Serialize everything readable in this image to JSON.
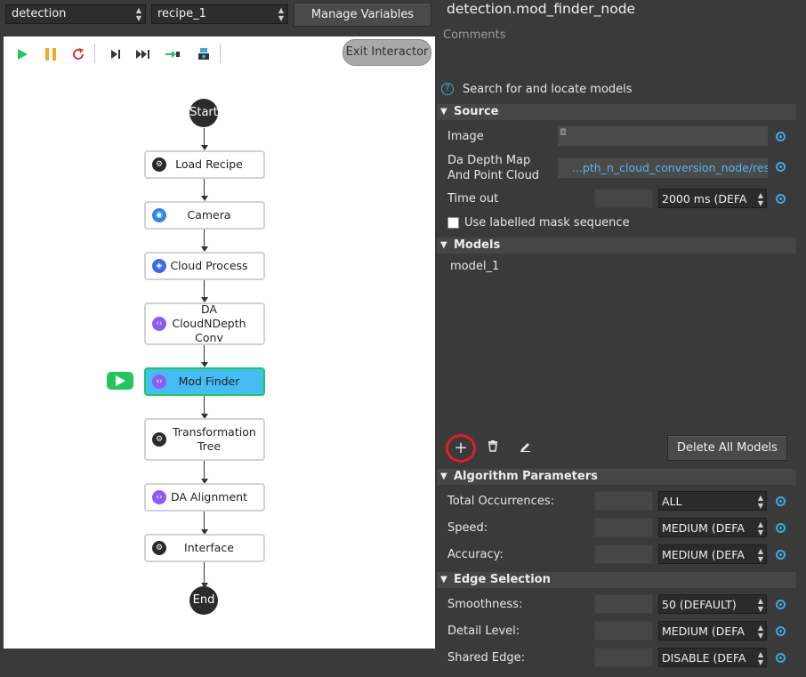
{
  "toolbar": {
    "project_select": "detection",
    "recipe_select": "recipe_1",
    "manage_variables": "Manage Variables"
  },
  "canvas": {
    "exit_interactor": "Exit Interactor",
    "start": "Start",
    "end": "End",
    "nodes": [
      {
        "label": "Load Recipe",
        "icon": "gear-icon"
      },
      {
        "label": "Camera",
        "icon": "camera-icon"
      },
      {
        "label": "Cloud Process",
        "icon": "cube-icon"
      },
      {
        "label": "DA CloudNDepth Conv",
        "icon": "code-icon"
      },
      {
        "label": "Mod Finder",
        "icon": "code-icon",
        "active": true
      },
      {
        "label": "Transformation Tree",
        "icon": "gear-icon"
      },
      {
        "label": "DA Alignment",
        "icon": "code-icon"
      },
      {
        "label": "Interface",
        "icon": "gear-icon"
      }
    ]
  },
  "panel": {
    "title": "detection.mod_finder_node",
    "comments": "Comments",
    "help_text": "Search for and locate models",
    "source": {
      "header": "Source",
      "image_label": "Image",
      "depth_label": "Da Depth Map And Point Cloud",
      "depth_value": "...pth_n_cloud_conversion_node/result",
      "timeout_label": "Time out",
      "timeout_value": "2000 ms (DEFA",
      "mask_seq_label": "Use labelled mask sequence"
    },
    "models": {
      "header": "Models",
      "items": [
        "model_1"
      ],
      "delete_all": "Delete All Models"
    },
    "algorithm": {
      "header": "Algorithm Parameters",
      "total_occ_label": "Total Occurrences:",
      "total_occ_value": "ALL",
      "speed_label": "Speed:",
      "speed_value": "MEDIUM (DEFA",
      "accuracy_label": "Accuracy:",
      "accuracy_value": "MEDIUM (DEFA"
    },
    "edge": {
      "header": "Edge Selection",
      "smoothness_label": "Smoothness:",
      "smoothness_value": "50 (DEFAULT)",
      "detail_label": "Detail Level:",
      "detail_value": "MEDIUM (DEFA",
      "shared_label": "Shared Edge:",
      "shared_value": "DISABLE (DEFA"
    }
  },
  "colors": {
    "accent_blue": "#3da9e0",
    "active_node": "#44bdf3",
    "running_green": "#22c55e",
    "highlight_red": "#e11d2a"
  }
}
